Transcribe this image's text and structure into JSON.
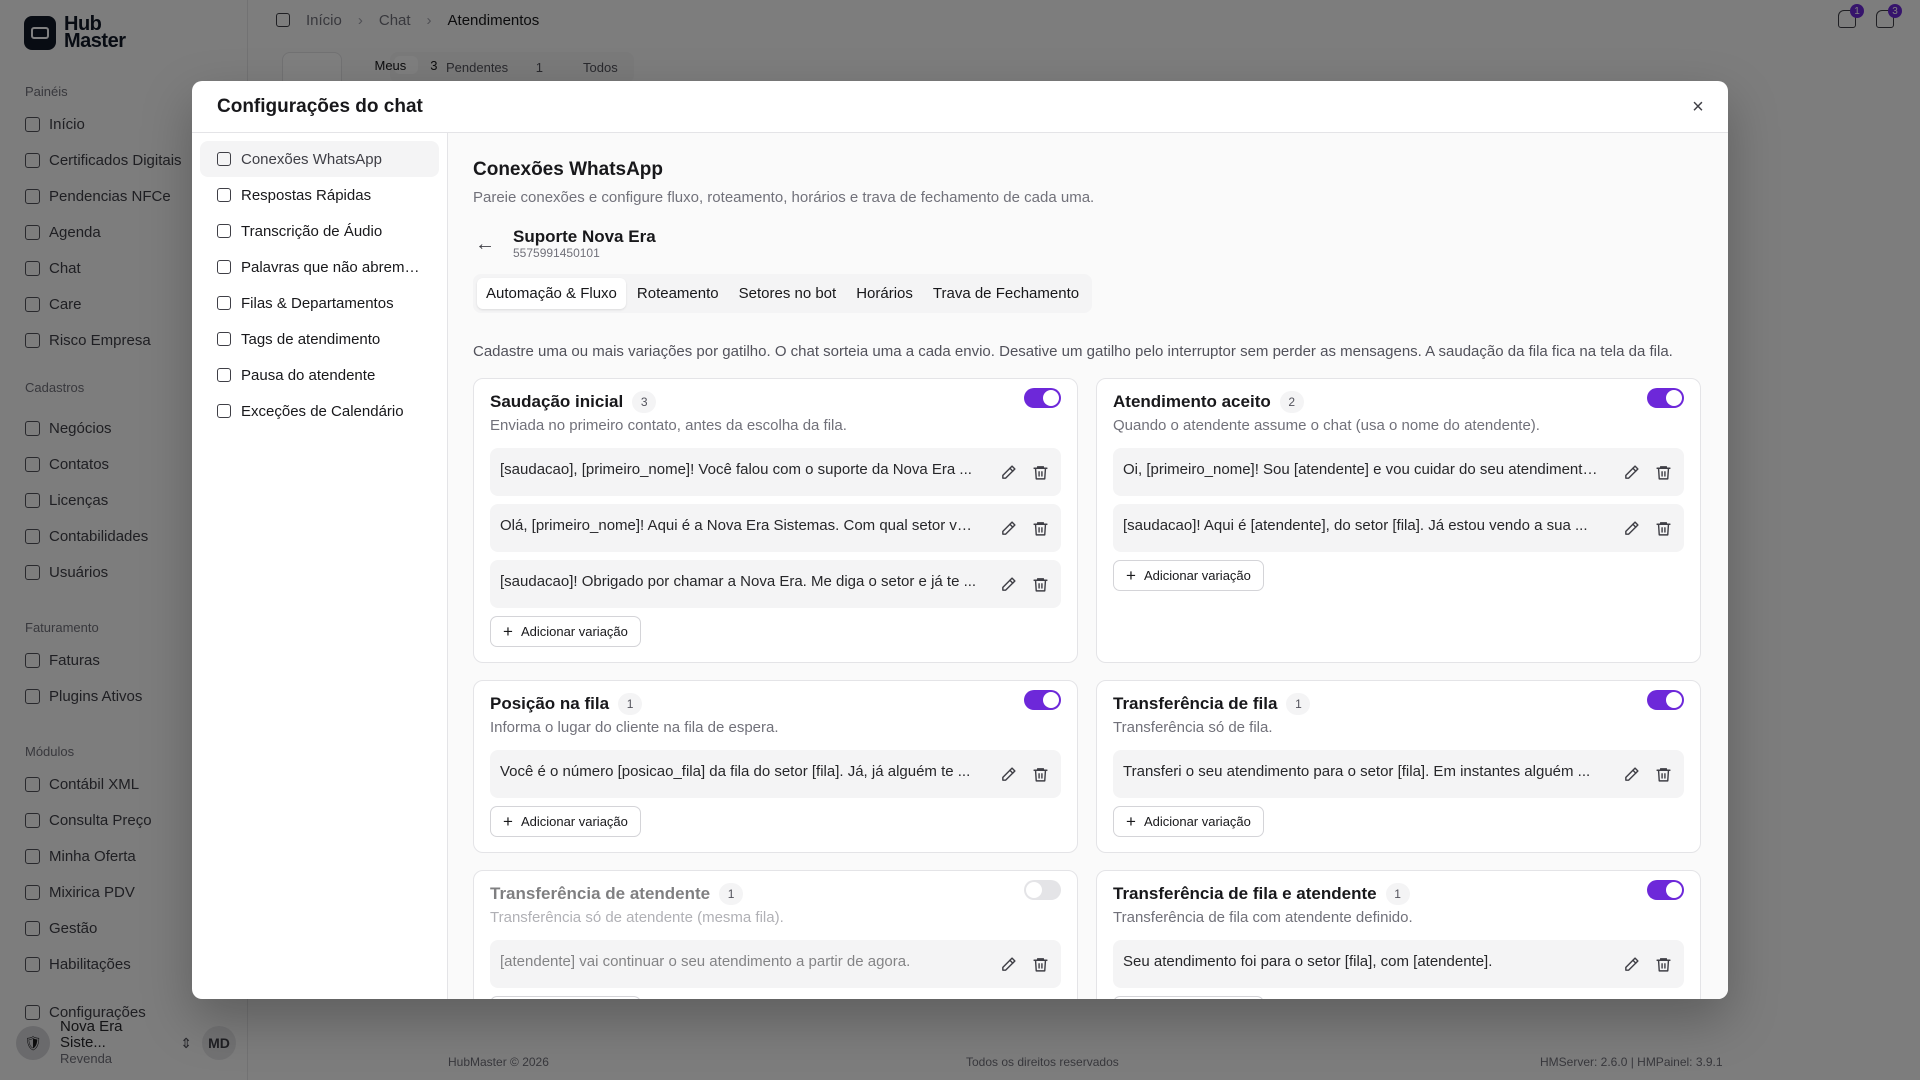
{
  "brand": {
    "line1": "Hub",
    "line2": "Master"
  },
  "sidebar": {
    "sections": [
      {
        "title": "Painéis",
        "items": [
          "Início",
          "Certificados Digitais",
          "Pendencias NFCe",
          "Agenda",
          "Chat",
          "Care",
          "Risco Empresa"
        ]
      },
      {
        "title": "Cadastros",
        "items": [
          "Negócios",
          "Contatos",
          "Licenças",
          "Contabilidades",
          "Usuários"
        ]
      },
      {
        "title": "Faturamento",
        "items": [
          "Faturas",
          "Plugins Ativos"
        ]
      },
      {
        "title": "Módulos",
        "items": [
          "Contábil XML",
          "Consulta Preço",
          "Minha Oferta",
          "Mixirica PDV",
          "Gestão",
          "Habilitações"
        ]
      }
    ],
    "settings": "Configurações",
    "org_name": "Nova Era Siste...",
    "org_role": "Revenda",
    "user_initials": "MD"
  },
  "topbar": {
    "breadcrumb": [
      "Início",
      "Chat",
      "Atendimentos"
    ],
    "notif_count_1": "1",
    "notif_count_2": "3"
  },
  "chat_tabs": [
    {
      "label": "Meus",
      "count": "3"
    },
    {
      "label": "Pendentes",
      "count": "1"
    },
    {
      "label": "Todos",
      "count": ""
    }
  ],
  "footer": {
    "copyright": "HubMaster © 2026",
    "rights": "Todos os direitos reservados",
    "version": "HMServer: 2.6.0 | HMPainel: 3.9.1"
  },
  "modal": {
    "title": "Configurações do chat",
    "close": "×",
    "nav": [
      {
        "label": "Conexões WhatsApp",
        "icon": "plug-icon"
      },
      {
        "label": "Respostas Rápidas",
        "icon": "zap-icon"
      },
      {
        "label": "Transcrição de Áudio",
        "icon": "captions-icon"
      },
      {
        "label": "Palavras que não abrem ...",
        "icon": "filter-icon"
      },
      {
        "label": "Filas & Departamentos",
        "icon": "list-icon"
      },
      {
        "label": "Tags de atendimento",
        "icon": "tag-icon"
      },
      {
        "label": "Pausa do atendente",
        "icon": "pause-icon"
      },
      {
        "label": "Exceções de Calendário",
        "icon": "calendar-icon"
      }
    ],
    "content": {
      "title": "Conexões WhatsApp",
      "subtitle": "Pareie conexões e configure fluxo, roteamento, horários e trava de fechamento de cada uma.",
      "connection_name": "Suporte Nova Era",
      "connection_number": "5575991450101",
      "tabs": [
        "Automação & Fluxo",
        "Roteamento",
        "Setores no bot",
        "Horários",
        "Trava de Fechamento"
      ],
      "info": "Cadastre uma ou mais variações por gatilho. O chat sorteia uma a cada envio. Desative um gatilho pelo interruptor sem perder as mensagens. A saudação da fila fica na tela da fila.",
      "add_label": "Adicionar variação",
      "triggers": [
        {
          "title": "Saudação inicial",
          "count": "3",
          "desc": "Enviada no primeiro contato, antes da escolha da fila.",
          "enabled": true,
          "messages": [
            "[saudacao], [primeiro_nome]! Você falou com o suporte da Nova Era ...",
            "Olá, [primeiro_nome]! Aqui é a Nova Era Sistemas. Com qual setor você...",
            "[saudacao]! Obrigado por chamar a Nova Era. Me diga o setor e já te ..."
          ]
        },
        {
          "title": "Atendimento aceito",
          "count": "2",
          "desc": "Quando o atendente assume o chat (usa o nome do atendente).",
          "enabled": true,
          "messages": [
            "Oi, [primeiro_nome]! Sou [atendente] e vou cuidar do seu atendimento. ...",
            "[saudacao]! Aqui é [atendente], do setor [fila]. Já estou vendo a sua ..."
          ]
        },
        {
          "title": "Posição na fila",
          "count": "1",
          "desc": "Informa o lugar do cliente na fila de espera.",
          "enabled": true,
          "messages": [
            "Você é o número [posicao_fila] da fila do setor [fila]. Já, já alguém te ..."
          ]
        },
        {
          "title": "Transferência de fila",
          "count": "1",
          "desc": "Transferência só de fila.",
          "enabled": true,
          "messages": [
            "Transferi o seu atendimento para o setor [fila]. Em instantes alguém ..."
          ]
        },
        {
          "title": "Transferência de atendente",
          "count": "1",
          "desc": "Transferência só de atendente (mesma fila).",
          "enabled": false,
          "messages": [
            "[atendente] vai continuar o seu atendimento a partir de agora."
          ]
        },
        {
          "title": "Transferência de fila e atendente",
          "count": "1",
          "desc": "Transferência de fila com atendente definido.",
          "enabled": true,
          "messages": [
            "Seu atendimento foi para o setor [fila], com [atendente]."
          ]
        }
      ]
    }
  }
}
